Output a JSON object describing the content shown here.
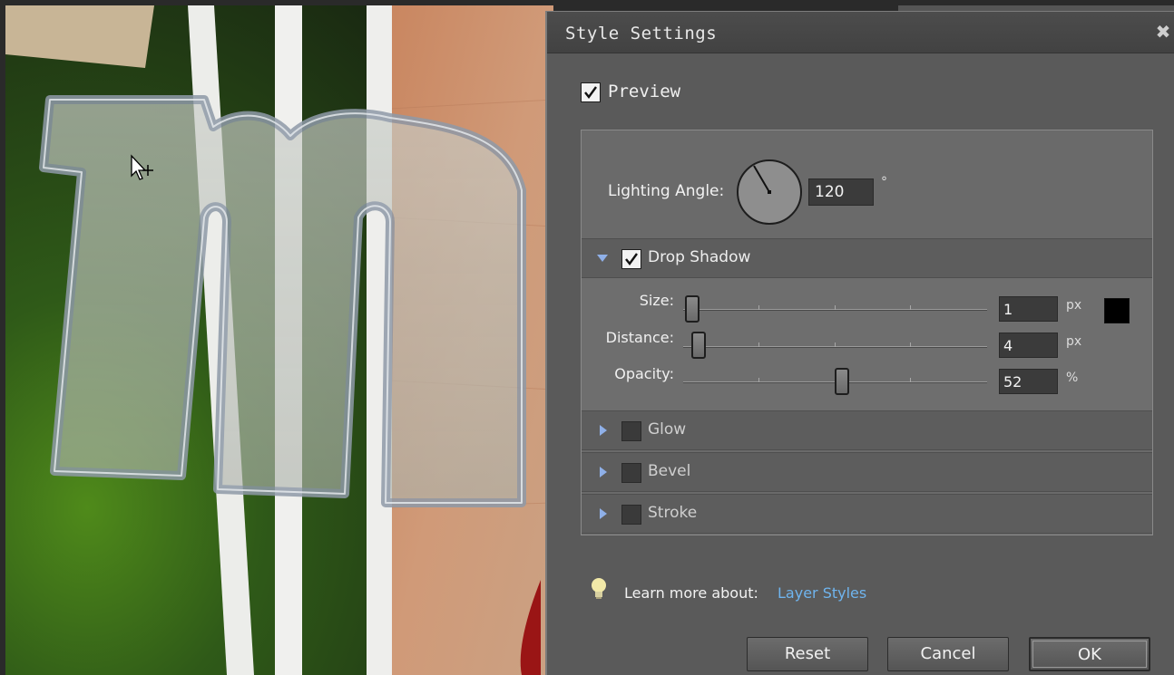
{
  "dialog": {
    "title": "Style Settings",
    "close_glyph": "✖",
    "preview": {
      "label": "Preview",
      "checked": true
    },
    "lighting": {
      "label": "Lighting Angle:",
      "value": "120",
      "unit": "°"
    },
    "sections": {
      "drop_shadow": {
        "label": "Drop Shadow",
        "checked": true,
        "expanded": true
      },
      "glow": {
        "label": "Glow",
        "checked": false,
        "expanded": false
      },
      "bevel": {
        "label": "Bevel",
        "checked": false,
        "expanded": false
      },
      "stroke": {
        "label": "Stroke",
        "checked": false,
        "expanded": false
      }
    },
    "drop_shadow": {
      "size": {
        "label": "Size:",
        "value": "1",
        "unit": "px"
      },
      "distance": {
        "label": "Distance:",
        "value": "4",
        "unit": "px"
      },
      "opacity": {
        "label": "Opacity:",
        "value": "52",
        "unit": "%"
      },
      "color": "#000000"
    },
    "learn": {
      "text": "Learn more about:",
      "link": "Layer Styles"
    },
    "buttons": {
      "reset": "Reset",
      "cancel": "Cancel",
      "ok": "OK"
    }
  },
  "colors": {
    "dialog_bg": "#5a5a5a",
    "panel_bg": "#6a6a6a",
    "link": "#6fb4ee",
    "expand_triangle": "#8fb0e8"
  },
  "icons": {
    "cursor": "move-cursor-icon",
    "close": "close-icon",
    "lightbulb": "lightbulb-icon",
    "expand": "triangle-down-icon",
    "collapsed": "triangle-right-icon"
  }
}
